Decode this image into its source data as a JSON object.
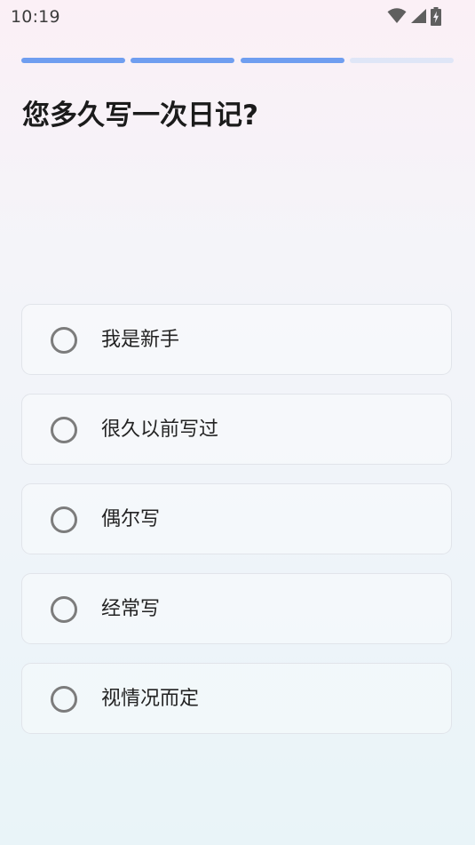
{
  "status_bar": {
    "time": "10:19",
    "icons": [
      "wifi-icon",
      "cell-signal-icon",
      "battery-charging-icon"
    ]
  },
  "progress": {
    "total_steps": 4,
    "completed_steps": 3
  },
  "question": {
    "title": "您多久写一次日记?"
  },
  "options": [
    {
      "label": "我是新手",
      "selected": false
    },
    {
      "label": "很久以前写过",
      "selected": false
    },
    {
      "label": "偶尔写",
      "selected": false
    },
    {
      "label": "经常写",
      "selected": false
    },
    {
      "label": "视情况而定",
      "selected": false
    }
  ],
  "colors": {
    "progress_done": "#6f9ef0",
    "progress_todo": "#dfe6f7",
    "radio_border": "#7c7c7c",
    "card_border": "#e1e4ea"
  }
}
